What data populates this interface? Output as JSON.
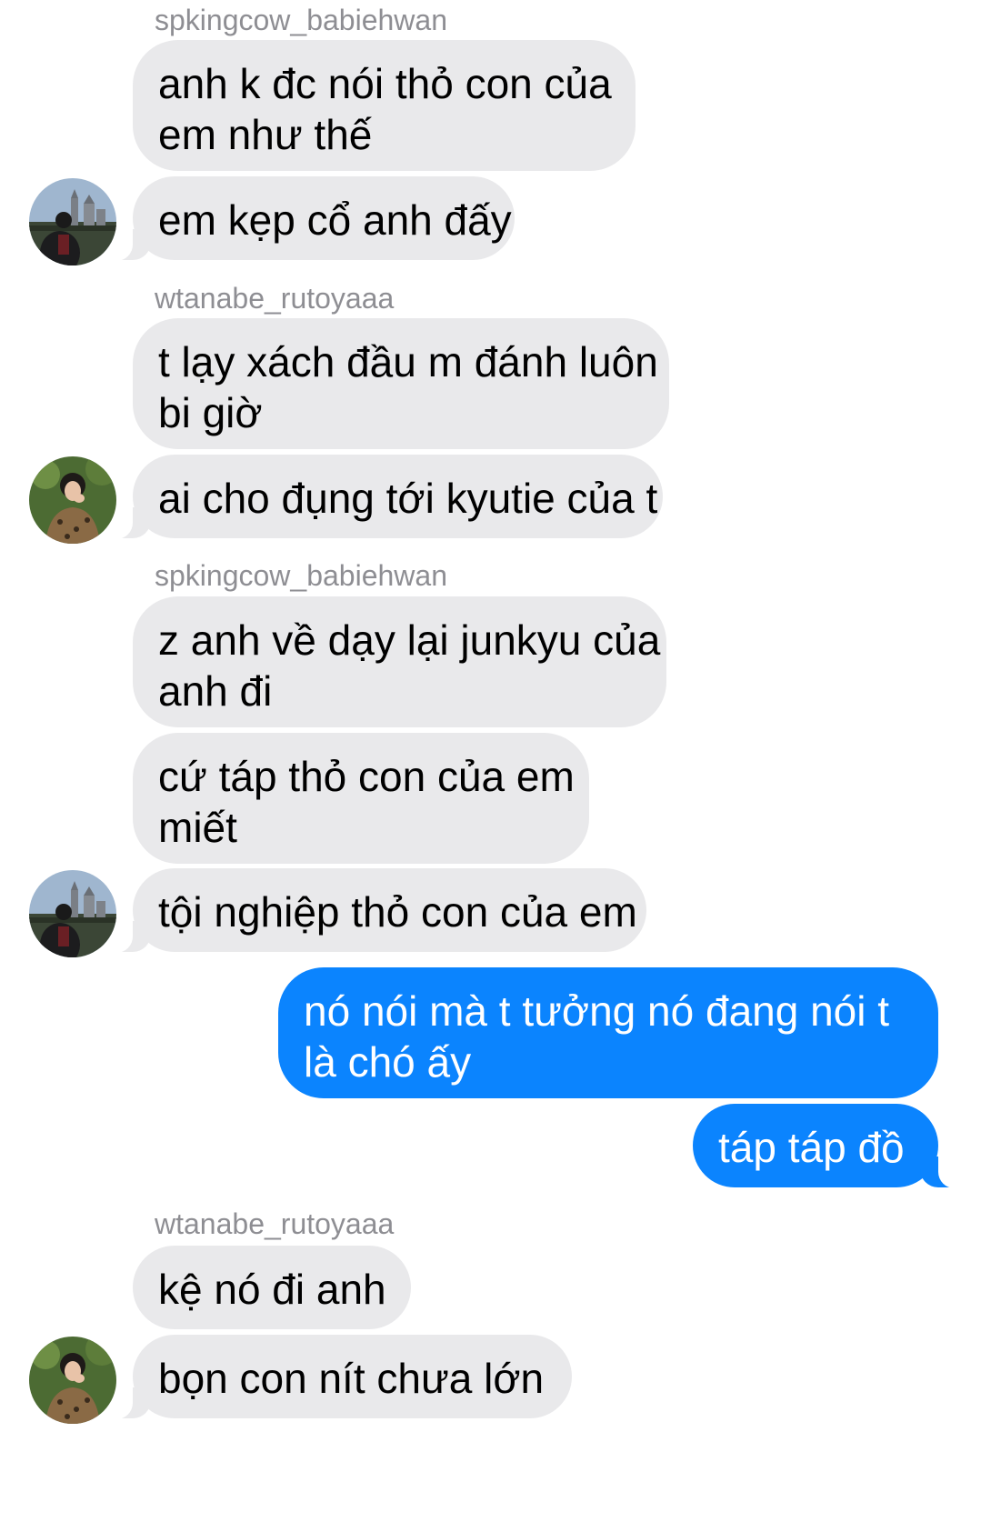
{
  "chat": {
    "messages": [
      {
        "sender": "spkingcow_babiehwan",
        "lines": [
          "anh k đc nói thỏ con của",
          "em như thế"
        ]
      },
      {
        "lines": [
          "em kẹp cổ anh đấy"
        ],
        "avatar": "castle-avatar-icon"
      },
      {
        "sender": "wtanabe_rutoyaaa",
        "lines": [
          "t lạy xách đầu m đánh luôn",
          "bi giờ"
        ]
      },
      {
        "lines": [
          "ai cho đụng tới kyutie của t"
        ],
        "avatar": "girl-avatar-icon"
      },
      {
        "sender": "spkingcow_babiehwan",
        "lines": [
          "z anh về dạy lại junkyu của",
          "anh đi"
        ]
      },
      {
        "lines": [
          "cứ táp thỏ con của em",
          "miết"
        ]
      },
      {
        "lines": [
          "tội nghiệp thỏ con của em"
        ],
        "avatar": "castle-avatar-icon"
      },
      {
        "lines": [
          "nó nói mà t tưởng nó đang nói t",
          "là chó ấy"
        ],
        "outgoing": true
      },
      {
        "lines": [
          "táp táp đồ"
        ],
        "outgoing": true
      },
      {
        "sender": "wtanabe_rutoyaaa",
        "lines": [
          "kệ nó đi anh"
        ]
      },
      {
        "lines": [
          "bọn con nít chưa lớn"
        ],
        "avatar": "girl-avatar-icon"
      }
    ]
  },
  "colors": {
    "incoming_bubble": "#e9e9eb",
    "outgoing_bubble": "#0b84fe",
    "sender_name": "#8e8e93"
  }
}
